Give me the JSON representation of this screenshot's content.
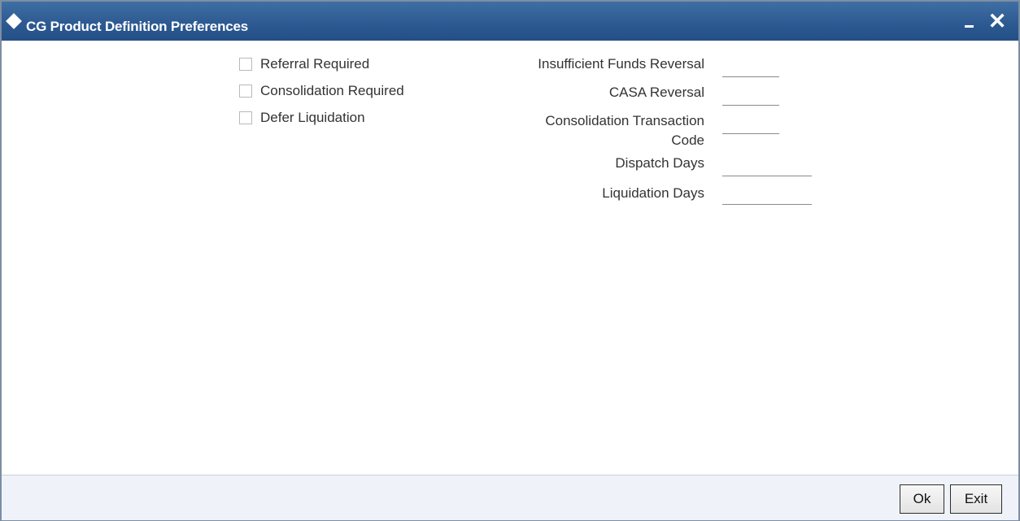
{
  "window": {
    "title": "CG Product Definition Preferences",
    "minimize_glyph": "",
    "close_glyph": "✕"
  },
  "checkboxes": [
    {
      "label": "Referral Required",
      "checked": false
    },
    {
      "label": "Consolidation Required",
      "checked": false
    },
    {
      "label": "Defer Liquidation",
      "checked": false
    }
  ],
  "fields": {
    "insufficient_funds_reversal": {
      "label": "Insufficient Funds Reversal",
      "value": ""
    },
    "casa_reversal": {
      "label": "CASA Reversal",
      "value": ""
    },
    "consolidation_transaction_code": {
      "label_line1": "Consolidation Transaction",
      "label_line2": "Code",
      "value": ""
    },
    "dispatch_days": {
      "label": "Dispatch Days",
      "value": ""
    },
    "liquidation_days": {
      "label": "Liquidation Days",
      "value": ""
    }
  },
  "footer": {
    "ok_label": "Ok",
    "exit_label": "Exit"
  },
  "colors": {
    "titlebar": "#2d5a92",
    "footer_bg": "#eff3f9",
    "text": "#333333"
  }
}
